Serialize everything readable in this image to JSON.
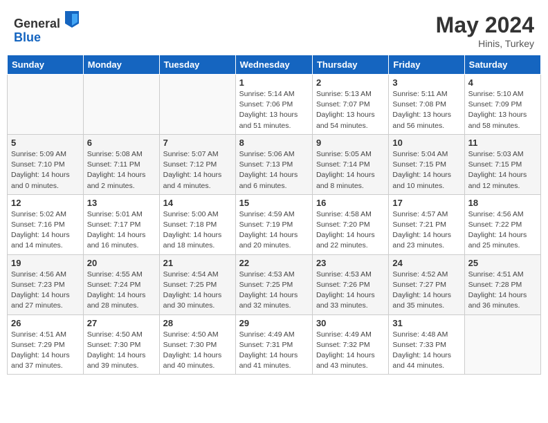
{
  "header": {
    "logo_general": "General",
    "logo_blue": "Blue",
    "month_year": "May 2024",
    "location": "Hinis, Turkey"
  },
  "weekdays": [
    "Sunday",
    "Monday",
    "Tuesday",
    "Wednesday",
    "Thursday",
    "Friday",
    "Saturday"
  ],
  "weeks": [
    [
      {
        "day": "",
        "info": ""
      },
      {
        "day": "",
        "info": ""
      },
      {
        "day": "",
        "info": ""
      },
      {
        "day": "1",
        "info": "Sunrise: 5:14 AM\nSunset: 7:06 PM\nDaylight: 13 hours\nand 51 minutes."
      },
      {
        "day": "2",
        "info": "Sunrise: 5:13 AM\nSunset: 7:07 PM\nDaylight: 13 hours\nand 54 minutes."
      },
      {
        "day": "3",
        "info": "Sunrise: 5:11 AM\nSunset: 7:08 PM\nDaylight: 13 hours\nand 56 minutes."
      },
      {
        "day": "4",
        "info": "Sunrise: 5:10 AM\nSunset: 7:09 PM\nDaylight: 13 hours\nand 58 minutes."
      }
    ],
    [
      {
        "day": "5",
        "info": "Sunrise: 5:09 AM\nSunset: 7:10 PM\nDaylight: 14 hours\nand 0 minutes."
      },
      {
        "day": "6",
        "info": "Sunrise: 5:08 AM\nSunset: 7:11 PM\nDaylight: 14 hours\nand 2 minutes."
      },
      {
        "day": "7",
        "info": "Sunrise: 5:07 AM\nSunset: 7:12 PM\nDaylight: 14 hours\nand 4 minutes."
      },
      {
        "day": "8",
        "info": "Sunrise: 5:06 AM\nSunset: 7:13 PM\nDaylight: 14 hours\nand 6 minutes."
      },
      {
        "day": "9",
        "info": "Sunrise: 5:05 AM\nSunset: 7:14 PM\nDaylight: 14 hours\nand 8 minutes."
      },
      {
        "day": "10",
        "info": "Sunrise: 5:04 AM\nSunset: 7:15 PM\nDaylight: 14 hours\nand 10 minutes."
      },
      {
        "day": "11",
        "info": "Sunrise: 5:03 AM\nSunset: 7:15 PM\nDaylight: 14 hours\nand 12 minutes."
      }
    ],
    [
      {
        "day": "12",
        "info": "Sunrise: 5:02 AM\nSunset: 7:16 PM\nDaylight: 14 hours\nand 14 minutes."
      },
      {
        "day": "13",
        "info": "Sunrise: 5:01 AM\nSunset: 7:17 PM\nDaylight: 14 hours\nand 16 minutes."
      },
      {
        "day": "14",
        "info": "Sunrise: 5:00 AM\nSunset: 7:18 PM\nDaylight: 14 hours\nand 18 minutes."
      },
      {
        "day": "15",
        "info": "Sunrise: 4:59 AM\nSunset: 7:19 PM\nDaylight: 14 hours\nand 20 minutes."
      },
      {
        "day": "16",
        "info": "Sunrise: 4:58 AM\nSunset: 7:20 PM\nDaylight: 14 hours\nand 22 minutes."
      },
      {
        "day": "17",
        "info": "Sunrise: 4:57 AM\nSunset: 7:21 PM\nDaylight: 14 hours\nand 23 minutes."
      },
      {
        "day": "18",
        "info": "Sunrise: 4:56 AM\nSunset: 7:22 PM\nDaylight: 14 hours\nand 25 minutes."
      }
    ],
    [
      {
        "day": "19",
        "info": "Sunrise: 4:56 AM\nSunset: 7:23 PM\nDaylight: 14 hours\nand 27 minutes."
      },
      {
        "day": "20",
        "info": "Sunrise: 4:55 AM\nSunset: 7:24 PM\nDaylight: 14 hours\nand 28 minutes."
      },
      {
        "day": "21",
        "info": "Sunrise: 4:54 AM\nSunset: 7:25 PM\nDaylight: 14 hours\nand 30 minutes."
      },
      {
        "day": "22",
        "info": "Sunrise: 4:53 AM\nSunset: 7:25 PM\nDaylight: 14 hours\nand 32 minutes."
      },
      {
        "day": "23",
        "info": "Sunrise: 4:53 AM\nSunset: 7:26 PM\nDaylight: 14 hours\nand 33 minutes."
      },
      {
        "day": "24",
        "info": "Sunrise: 4:52 AM\nSunset: 7:27 PM\nDaylight: 14 hours\nand 35 minutes."
      },
      {
        "day": "25",
        "info": "Sunrise: 4:51 AM\nSunset: 7:28 PM\nDaylight: 14 hours\nand 36 minutes."
      }
    ],
    [
      {
        "day": "26",
        "info": "Sunrise: 4:51 AM\nSunset: 7:29 PM\nDaylight: 14 hours\nand 37 minutes."
      },
      {
        "day": "27",
        "info": "Sunrise: 4:50 AM\nSunset: 7:30 PM\nDaylight: 14 hours\nand 39 minutes."
      },
      {
        "day": "28",
        "info": "Sunrise: 4:50 AM\nSunset: 7:30 PM\nDaylight: 14 hours\nand 40 minutes."
      },
      {
        "day": "29",
        "info": "Sunrise: 4:49 AM\nSunset: 7:31 PM\nDaylight: 14 hours\nand 41 minutes."
      },
      {
        "day": "30",
        "info": "Sunrise: 4:49 AM\nSunset: 7:32 PM\nDaylight: 14 hours\nand 43 minutes."
      },
      {
        "day": "31",
        "info": "Sunrise: 4:48 AM\nSunset: 7:33 PM\nDaylight: 14 hours\nand 44 minutes."
      },
      {
        "day": "",
        "info": ""
      }
    ]
  ]
}
